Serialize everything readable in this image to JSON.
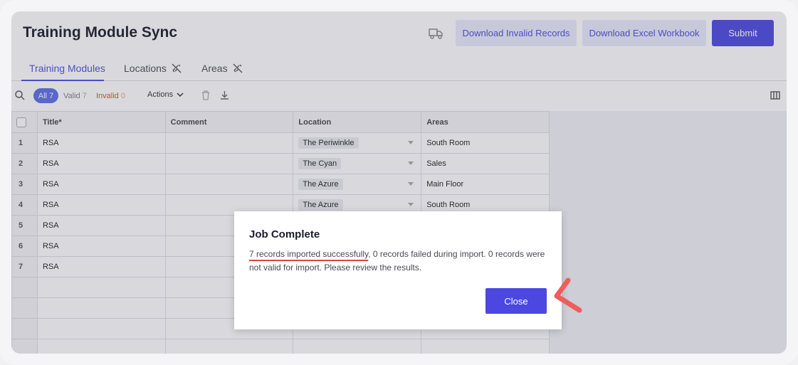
{
  "header": {
    "title": "Training Module Sync",
    "download_invalid_label": "Download Invalid Records",
    "download_excel_label": "Download Excel Workbook",
    "submit_label": "Submit",
    "truck_icon": "truck-icon"
  },
  "tabs": [
    {
      "label": "Training Modules",
      "active": true
    },
    {
      "label": "Locations",
      "icon": "no-link-icon"
    },
    {
      "label": "Areas",
      "icon": "no-link-icon"
    }
  ],
  "toolbar": {
    "all_label": "All",
    "all_count": "7",
    "valid_label": "Valid",
    "valid_count": "7",
    "invalid_label": "Invalid",
    "invalid_count": "0",
    "actions_label": "Actions"
  },
  "table": {
    "columns": [
      "Title*",
      "Comment",
      "Location",
      "Areas"
    ],
    "rows": [
      {
        "num": "1",
        "title": "RSA",
        "comment": "",
        "location": "The Periwinkle",
        "areas": "South Room"
      },
      {
        "num": "2",
        "title": "RSA",
        "comment": "",
        "location": "The Cyan",
        "areas": "Sales"
      },
      {
        "num": "3",
        "title": "RSA",
        "comment": "",
        "location": "The Azure",
        "areas": "Main Floor"
      },
      {
        "num": "4",
        "title": "RSA",
        "comment": "",
        "location": "The Azure",
        "areas": "South Room"
      },
      {
        "num": "5",
        "title": "RSA",
        "comment": "",
        "location": "",
        "areas": ""
      },
      {
        "num": "6",
        "title": "RSA",
        "comment": "",
        "location": "",
        "areas": ""
      },
      {
        "num": "7",
        "title": "RSA",
        "comment": "",
        "location": "",
        "areas": ""
      }
    ]
  },
  "modal": {
    "title": "Job Complete",
    "highlight": "7 records imported successfully",
    "body_rest": ", 0 records failed during import. 0 records were not valid for import. Please review the results.",
    "close_label": "Close"
  },
  "colors": {
    "accent": "#4b47e0",
    "invalid": "#d0542c",
    "annotation": "#f25c5c"
  }
}
